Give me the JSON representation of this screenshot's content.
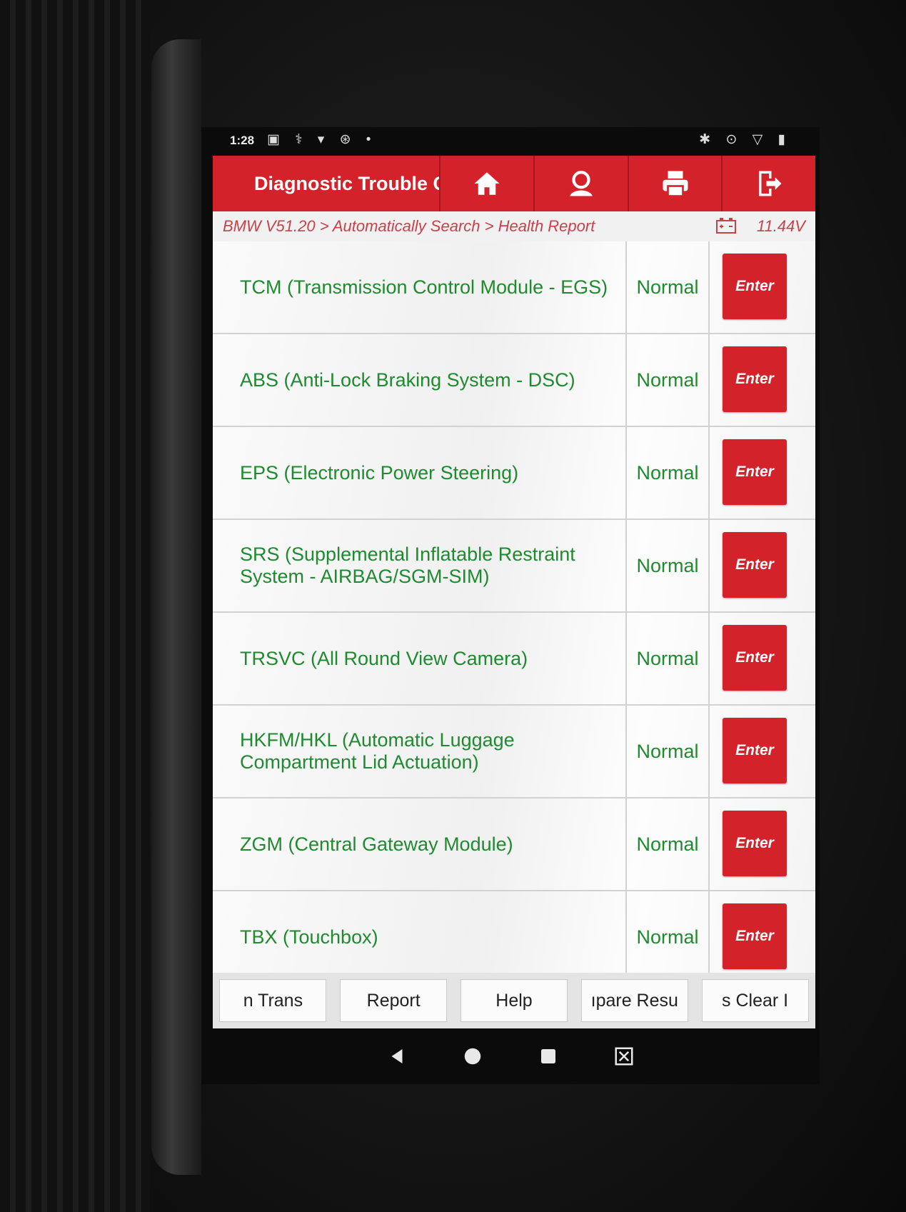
{
  "status_bar": {
    "time": "1:28"
  },
  "app": {
    "title": "Diagnostic Trouble C",
    "toolbar_icons": [
      "home-icon",
      "technician-icon",
      "print-icon",
      "exit-icon"
    ],
    "breadcrumb": "BMW V51.20 > Automatically Search > Health Report",
    "voltage": "11.44V"
  },
  "modules": [
    {
      "name": "TCM (Transmission Control Module - EGS)",
      "status": "Normal",
      "action": "Enter"
    },
    {
      "name": "ABS (Anti-Lock Braking System - DSC)",
      "status": "Normal",
      "action": "Enter"
    },
    {
      "name": "EPS (Electronic Power Steering)",
      "status": "Normal",
      "action": "Enter"
    },
    {
      "name": "SRS (Supplemental Inflatable Restraint System - AIRBAG/SGM-SIM)",
      "status": "Normal",
      "action": "Enter"
    },
    {
      "name": "TRSVC (All Round View Camera)",
      "status": "Normal",
      "action": "Enter"
    },
    {
      "name": "HKFM/HKL (Automatic Luggage Compartment Lid Actuation)",
      "status": "Normal",
      "action": "Enter"
    },
    {
      "name": "ZGM (Central Gateway Module)",
      "status": "Normal",
      "action": "Enter"
    },
    {
      "name": "TBX (Touchbox)",
      "status": "Normal",
      "action": "Enter"
    }
  ],
  "bottom_buttons": [
    "n   Trans",
    "Report",
    "Help",
    "ıpare Resu",
    "s   Clear I"
  ],
  "colors": {
    "brand_red": "#d4222b",
    "status_green": "#1f8a2f",
    "breadcrumb_red": "#c8414a"
  }
}
